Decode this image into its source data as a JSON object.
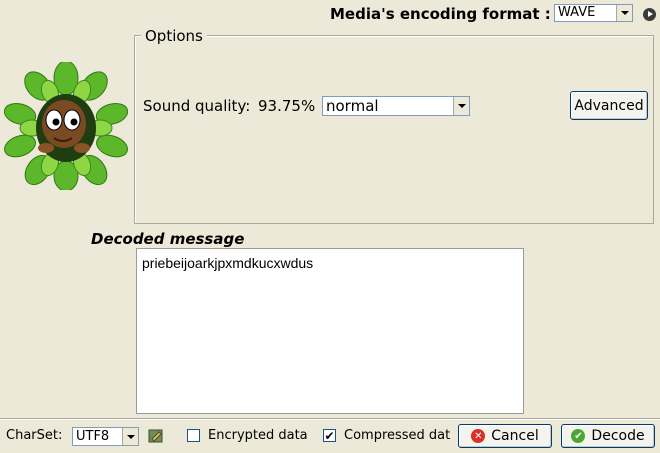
{
  "header": {
    "format_label": "Media's encoding format :",
    "format_value": "WAVE",
    "play_icon": "play-circle-icon"
  },
  "options": {
    "legend": "Options",
    "quality_label": "Sound quality:",
    "quality_value": "93.75%",
    "quality_select": "normal",
    "advanced_label": "Advanced"
  },
  "mascot": {
    "icon": "mascot-in-leaves-icon"
  },
  "decoded": {
    "label": "Decoded message",
    "message": "priebeijoarkjpxmdkucxwdus"
  },
  "footer": {
    "charset_label": "CharSet:",
    "charset_value": "UTF8",
    "edit_icon": "edit-charset-icon",
    "encrypted_label": "Encrypted data",
    "encrypted_checked": false,
    "compressed_label": "Compressed dat",
    "compressed_checked": true,
    "cancel_label": "Cancel",
    "decode_label": "Decode"
  }
}
